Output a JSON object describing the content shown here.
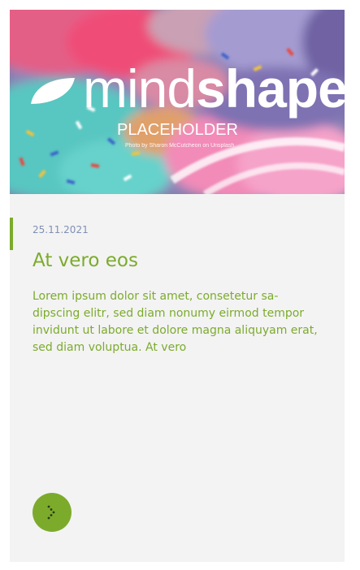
{
  "teaser": {
    "image": {
      "logo_light": "mind",
      "logo_bold": "shape",
      "overlay_label": "PLACEHOLDER",
      "photo_credit": "Photo by Sharon McCutcheon on Unsplash"
    },
    "date": "25.11.2021",
    "title": "At vero eos",
    "text": "Lorem ipsum dolor sit amet, consetetur sa-dipscing elitr, sed diam nonumy eirmod tempor invidunt ut labore et dolore magna aliquyam erat, sed diam voluptua. At vero",
    "more_button_icon": "chevron-right-icon"
  },
  "colors": {
    "accent": "#7cab2c",
    "date": "#7f8fb4",
    "card_background": "#f3f3f3"
  }
}
